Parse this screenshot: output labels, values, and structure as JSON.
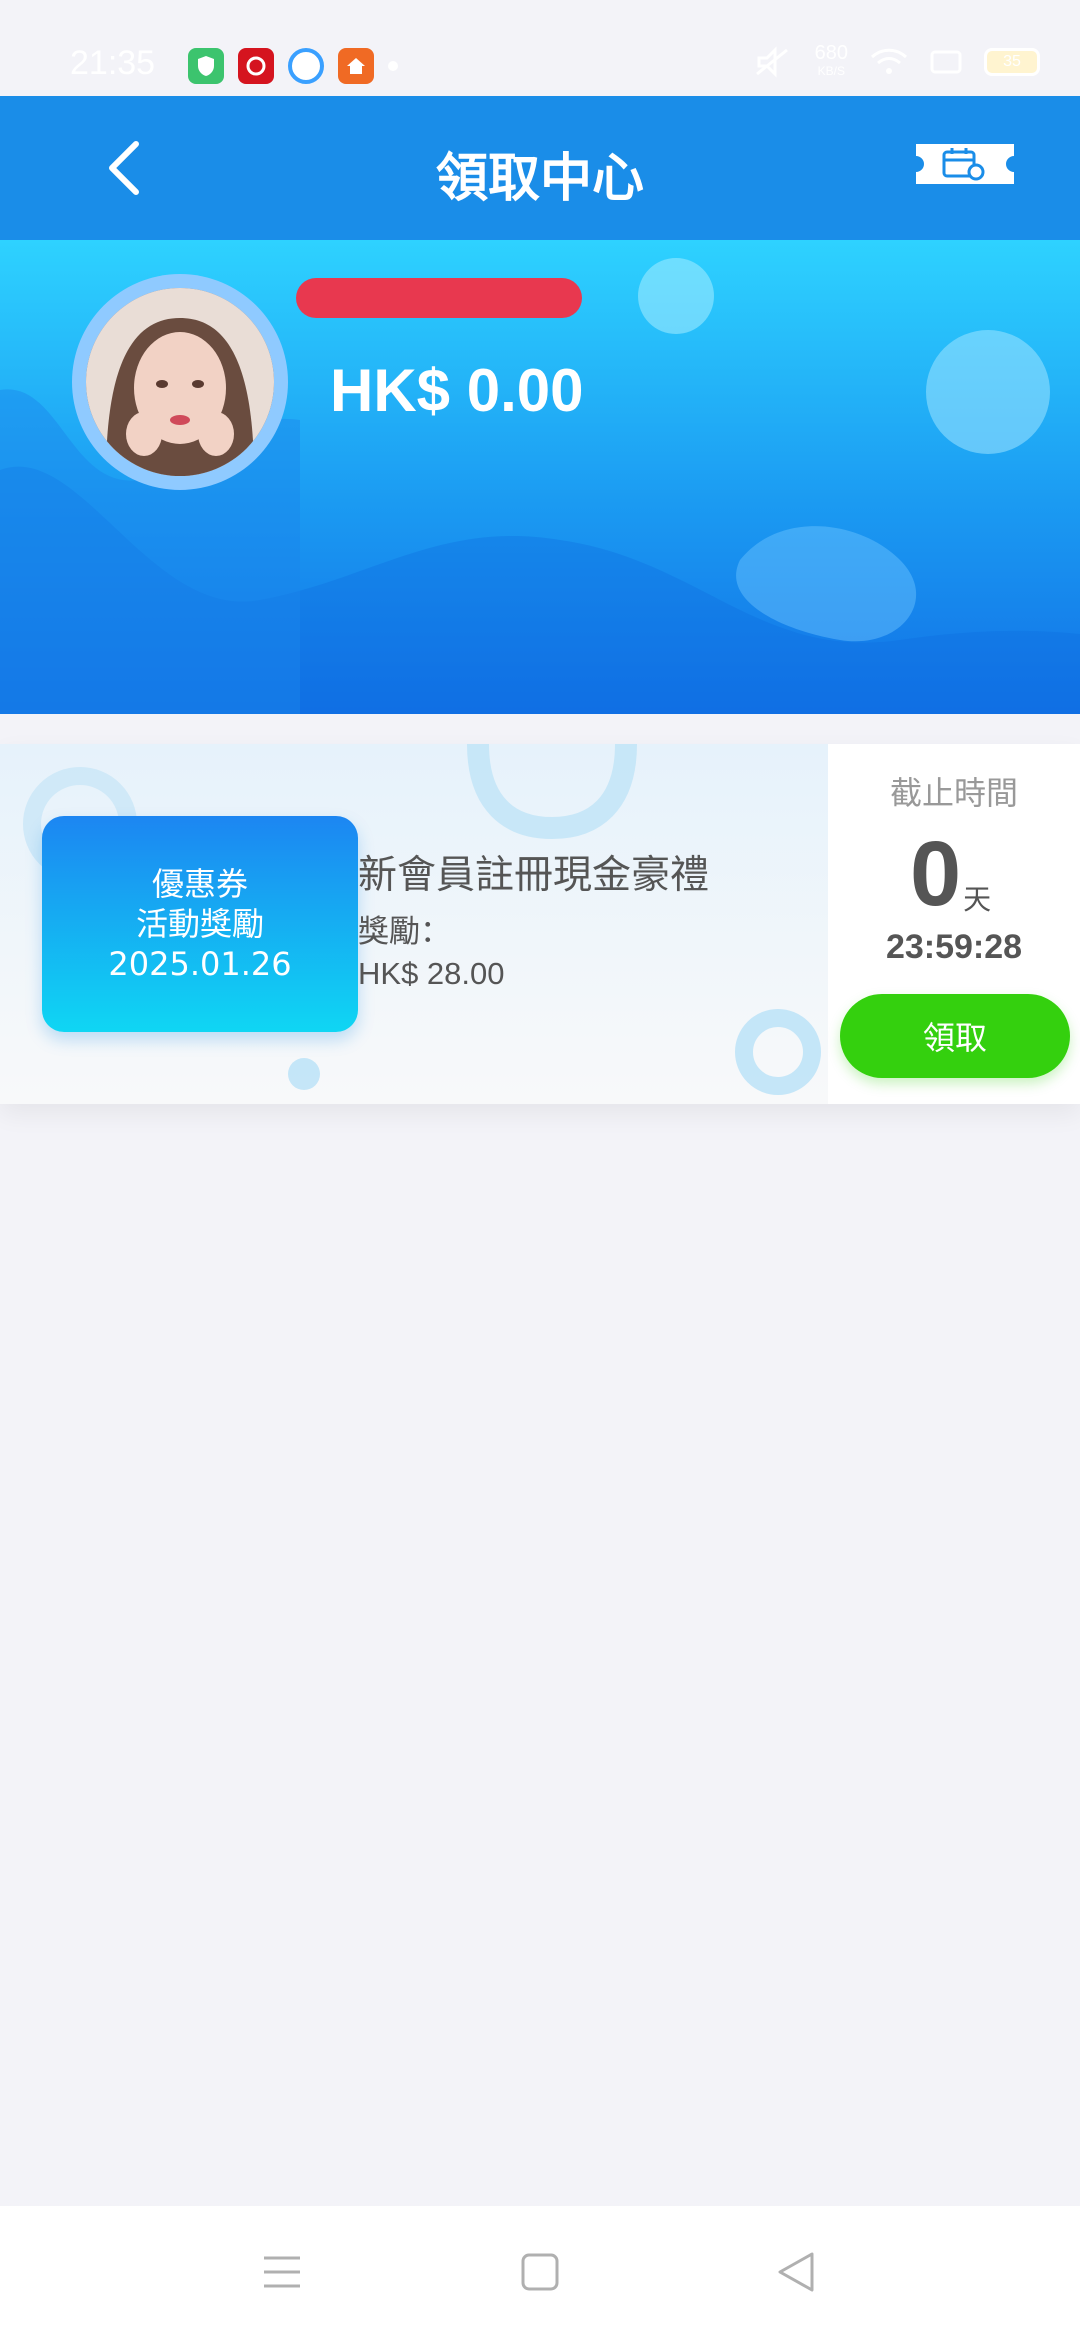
{
  "status_bar": {
    "time": "21:35",
    "network_speed": "680",
    "network_unit": "KB/S",
    "battery": "35"
  },
  "header": {
    "title": "領取中心"
  },
  "profile": {
    "balance": "HK$ 0.00"
  },
  "reward": {
    "badge_line1": "優惠券",
    "badge_line2": "活動獎勵",
    "badge_date": "2025.01.26",
    "title": "新會員註冊現金豪禮",
    "reward_label": "獎勵：",
    "reward_amount": "HK$ 28.00",
    "deadline_label": "截止時間",
    "days": "0",
    "days_unit": "天",
    "countdown": "23:59:28",
    "claim_label": "領取"
  },
  "colors": {
    "header_blue": "#1a8de8",
    "claim_green": "#34d00e",
    "redaction_red": "#e8384f"
  }
}
